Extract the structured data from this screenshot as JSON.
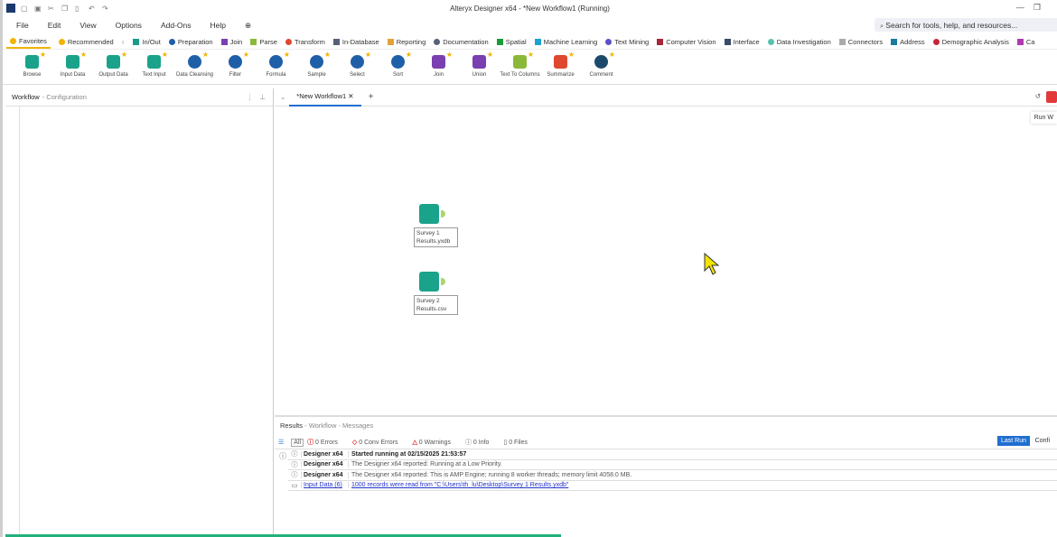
{
  "window": {
    "title": "Alteryx Designer x64 - *New Workflow1 (Running)"
  },
  "menu": [
    "File",
    "Edit",
    "View",
    "Options",
    "Add-Ons",
    "Help"
  ],
  "search_placeholder": "Search for tools, help, and resources...",
  "categories": [
    {
      "label": "Favorites",
      "color": "#f2b400"
    },
    {
      "label": "Recommended",
      "color": "#f2b400"
    },
    {
      "label": "In/Out",
      "color": "#1a9b8a"
    },
    {
      "label": "Preparation",
      "color": "#1f5fa8"
    },
    {
      "label": "Join",
      "color": "#7a3fb0"
    },
    {
      "label": "Parse",
      "color": "#8cb83a"
    },
    {
      "label": "Transform",
      "color": "#e0472f"
    },
    {
      "label": "In-Database",
      "color": "#56607a"
    },
    {
      "label": "Reporting",
      "color": "#e3a13a"
    },
    {
      "label": "Documentation",
      "color": "#56607a"
    },
    {
      "label": "Spatial",
      "color": "#1a9b3a"
    },
    {
      "label": "Machine Learning",
      "color": "#1aa3d0"
    },
    {
      "label": "Text Mining",
      "color": "#5a50c8"
    },
    {
      "label": "Computer Vision",
      "color": "#a8243a"
    },
    {
      "label": "Interface",
      "color": "#3a4a6a"
    },
    {
      "label": "Data Investigation",
      "color": "#5ac0b0"
    },
    {
      "label": "Connectors",
      "color": "#aaaaaa"
    },
    {
      "label": "Address",
      "color": "#1a7aa0"
    },
    {
      "label": "Demographic Analysis",
      "color": "#c8243a"
    },
    {
      "label": "Ca",
      "color": "#b03ab0"
    }
  ],
  "tools": [
    {
      "label": "Browse",
      "color": "#1aa38a"
    },
    {
      "label": "Input Data",
      "color": "#1aa38a"
    },
    {
      "label": "Output Data",
      "color": "#1aa38a"
    },
    {
      "label": "Text Input",
      "color": "#1aa38a"
    },
    {
      "label": "Data Cleansing",
      "color": "#1f5fa8"
    },
    {
      "label": "Filter",
      "color": "#1f5fa8"
    },
    {
      "label": "Formula",
      "color": "#1f5fa8"
    },
    {
      "label": "Sample",
      "color": "#1f5fa8"
    },
    {
      "label": "Select",
      "color": "#1f5fa8"
    },
    {
      "label": "Sort",
      "color": "#1f5fa8"
    },
    {
      "label": "Join",
      "color": "#7a3fb0"
    },
    {
      "label": "Union",
      "color": "#7a3fb0"
    },
    {
      "label": "Text To Columns",
      "color": "#8cb83a"
    },
    {
      "label": "Summarize",
      "color": "#e0472f"
    },
    {
      "label": "Comment",
      "color": "#1d4a6a"
    }
  ],
  "left_panel": {
    "title": "Workflow",
    "subtitle": "- Configuration"
  },
  "canvas": {
    "tab": "*New Workflow1",
    "run_tooltip": "Run W",
    "nodes": [
      {
        "label": "Survey 1 Results.yxdb"
      },
      {
        "label": "Survey 2 Results.csv"
      }
    ]
  },
  "results": {
    "title": "Results",
    "subtitle": "- Workflow - Messages",
    "filters": [
      "All",
      "0 Errors",
      "0 Conv Errors",
      "0 Warnings",
      "0 Info",
      "0 Files"
    ],
    "last_run": "Last Run",
    "config": "Confi",
    "rows": [
      {
        "source": "Designer x64",
        "message": "Started running at 02/15/2025 21:53:57"
      },
      {
        "source": "Designer x64",
        "message": "The Designer x64 reported: Running at a Low Priority."
      },
      {
        "source": "Designer x64",
        "message": "The Designer x64 reported: This is AMP Engine; running 8 worker threads; memory limit 4058.0 MB."
      },
      {
        "source": "Input Data (6)",
        "message": "1000 records were read from \"C:\\Users\\th_lu\\Desktop\\Survey 1 Results.yxdb\""
      }
    ]
  }
}
